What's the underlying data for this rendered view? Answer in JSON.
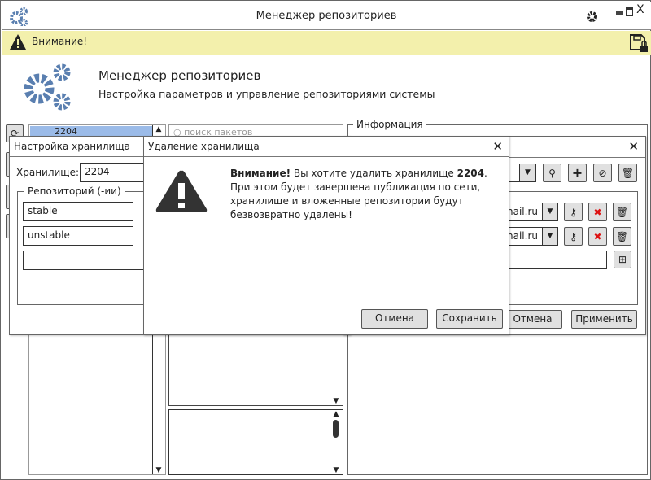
{
  "window": {
    "title": "Менеджер репозиториев"
  },
  "warning": {
    "text": "Внимание!"
  },
  "header": {
    "title": "Менеджер репозиториев",
    "subtitle": "Настройка параметров и управление репозиториями системы"
  },
  "tree": {
    "selected": "2204"
  },
  "search": {
    "placeholder": "поиск пакетов"
  },
  "info": {
    "legend": "Информация"
  },
  "storage_dialog": {
    "title": "Настройка хранилища",
    "storage_label": "Хранилище:",
    "storage_value": "2204",
    "repo_legend": "Репозиторий (-ии)",
    "repos": [
      "stable",
      "unstable",
      ""
    ]
  },
  "keys_dialog": {
    "emails": [
      "mail.ru",
      "mail.ru"
    ],
    "cancel": "Отмена",
    "apply": "Применить"
  },
  "delete_dialog": {
    "title": "Удаление хранилища",
    "msg_bold": "Внимание!",
    "msg_1": " Вы хотите удалить хранилище ",
    "msg_name": "2204",
    "msg_2": ".",
    "line2": "При этом будет завершена публикация по сети,",
    "line3": "хранилище и вложенные репозитории будут",
    "line4": "безвозвратно удалены!",
    "cancel": "Отмена",
    "save": "Сохранить"
  },
  "colors": {
    "accent": "#5a7fb0",
    "warnbar": "#f3f0ac",
    "selected": "#9bbbe8",
    "danger": "#dd1111"
  }
}
